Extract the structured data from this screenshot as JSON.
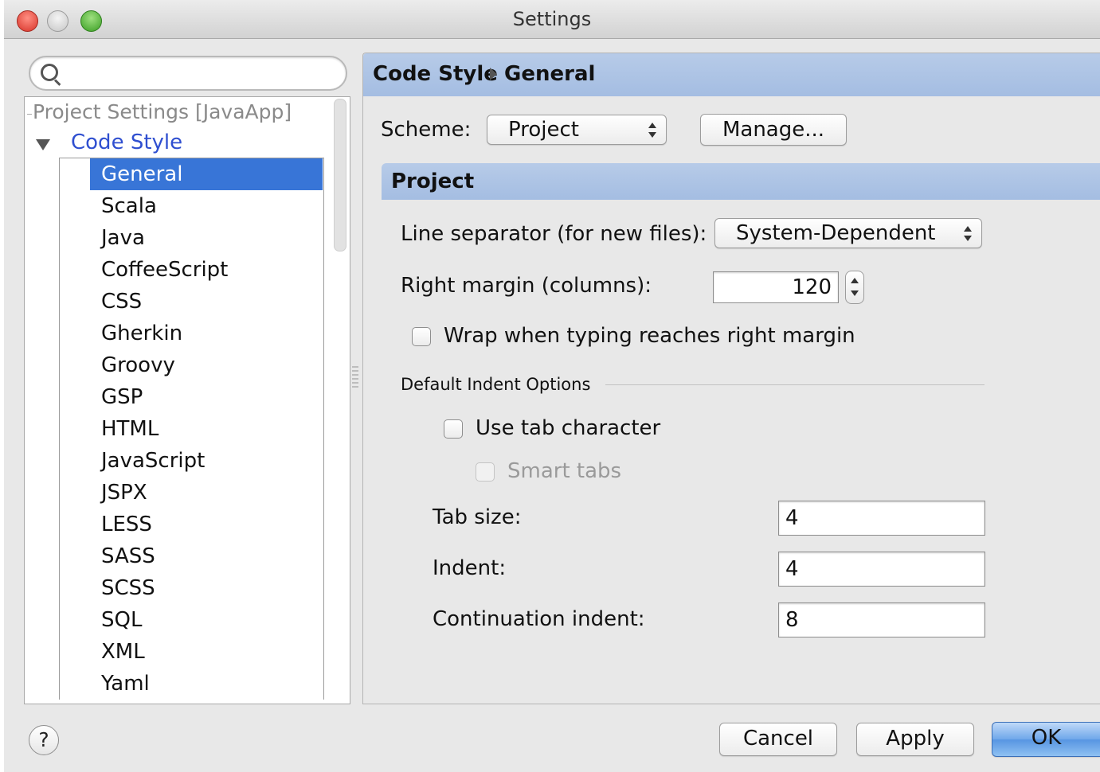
{
  "window": {
    "title": "Settings"
  },
  "search": {
    "placeholder": "",
    "value": ""
  },
  "tree": {
    "project_header": "Project Settings [JavaApp]",
    "code_style": "Code Style",
    "items": [
      {
        "label": "General",
        "selected": true
      },
      {
        "label": "Scala"
      },
      {
        "label": "Java"
      },
      {
        "label": "CoffeeScript"
      },
      {
        "label": "CSS"
      },
      {
        "label": "Gherkin"
      },
      {
        "label": "Groovy"
      },
      {
        "label": "GSP"
      },
      {
        "label": "HTML"
      },
      {
        "label": "JavaScript"
      },
      {
        "label": "JSPX"
      },
      {
        "label": "LESS"
      },
      {
        "label": "SASS"
      },
      {
        "label": "SCSS"
      },
      {
        "label": "SQL"
      },
      {
        "label": "XML"
      },
      {
        "label": "Yaml"
      }
    ]
  },
  "breadcrumb": {
    "parent": "Code Style",
    "current": "General"
  },
  "scheme": {
    "label": "Scheme:",
    "value": "Project",
    "manage_label": "Manage..."
  },
  "section": {
    "title": "Project"
  },
  "line_separator": {
    "label": "Line separator (for new files):",
    "value": "System-Dependent"
  },
  "right_margin": {
    "label": "Right margin (columns):",
    "value": "120"
  },
  "wrap": {
    "label": "Wrap when typing reaches right margin",
    "checked": false
  },
  "indent_options": {
    "group_title": "Default Indent Options",
    "use_tab_label": "Use tab character",
    "smart_tabs_label": "Smart tabs",
    "tab_size_label": "Tab size:",
    "tab_size_value": "4",
    "indent_label": "Indent:",
    "indent_value": "4",
    "continuation_label": "Continuation indent:",
    "continuation_value": "8"
  },
  "footer": {
    "help": "?",
    "cancel": "Cancel",
    "apply": "Apply",
    "ok": "OK"
  },
  "colors": {
    "selection": "#3875d7",
    "header_blue": "#a4bde2",
    "link_blue": "#2f4fd0"
  }
}
